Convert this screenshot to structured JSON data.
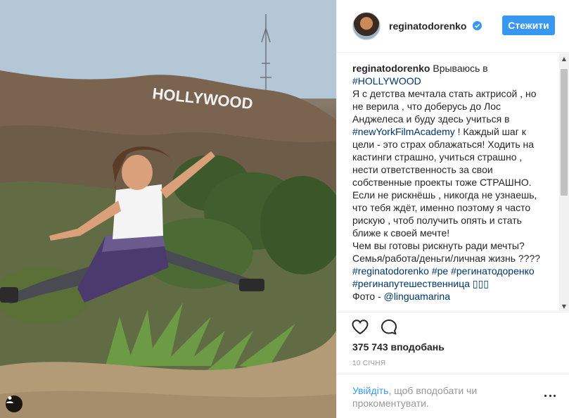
{
  "post": {
    "photo": {
      "sign_text": "HOLLYWOOD"
    },
    "author": {
      "username": "reginatodorenko",
      "verified": true
    },
    "follow_label": "Стежити",
    "caption": {
      "username": "reginatodorenko",
      "lines": [
        "Врываюсь в",
        "#HOLLYWOOD",
        "Я с детства мечтала стать актрисой , но",
        "не верила , что доберусь до Лос",
        "Анджелеса и буду здесь учиться в",
        "#newYorkFilmAcademy",
        "! Каждый шаг к",
        "цели - это страх облажаться! Ходить на",
        "кастинги страшно, учиться страшно ,",
        "нести ответственность за свои",
        "собственные проекты тоже СТРАШНО.",
        "Если не рискнёшь , никогда не узнаешь,",
        "что тебя ждёт, именно поэтому я часто",
        "рискую , чтоб получить опять и стать",
        "ближе к своей мечте!",
        "Чем вы готовы рискнуть ради мечты?",
        "Семья/работа/деньги/личная жизнь ????",
        "#reginatodorenko #ре #регинатодоренко",
        "#регинапутешественница ▯▯▯",
        "Фото -",
        "@linguamarina"
      ]
    },
    "likes": "375 743 вподобань",
    "date": "10 січня",
    "login_prompt": {
      "link": "Увійдіть",
      "text_line1": ", щоб вподобати чи",
      "text_line2": "прокоментувати."
    },
    "icons": {
      "like": "heart-icon",
      "comment": "comment-icon",
      "more": "more-options-icon",
      "user_tag": "user-icon",
      "verified": "verified-badge-icon"
    },
    "colors": {
      "accent": "#3897f0",
      "hashtag": "#003569",
      "muted": "#999999",
      "text": "#262626"
    }
  }
}
